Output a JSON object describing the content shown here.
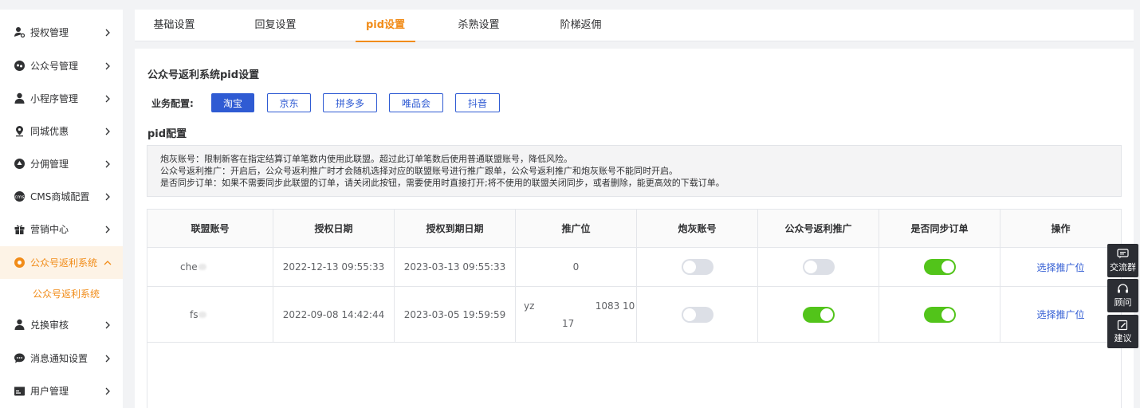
{
  "sidebar": {
    "items": [
      {
        "label": "授权管理",
        "icon": "user-key-icon",
        "active": false
      },
      {
        "label": "公众号管理",
        "icon": "chat-bubble-icon",
        "active": false
      },
      {
        "label": "小程序管理",
        "icon": "person-icon",
        "active": false
      },
      {
        "label": "同城优惠",
        "icon": "location-pin-icon",
        "active": false
      },
      {
        "label": "分佣管理",
        "icon": "triangle-badge-icon",
        "active": false
      },
      {
        "label": "CMS商城配置",
        "icon": "cms-icon",
        "active": false
      },
      {
        "label": "营销中心",
        "icon": "gift-icon",
        "active": false
      },
      {
        "label": "公众号返利系统",
        "icon": "orange-circle-icon",
        "active": true
      },
      {
        "label": "兑换审核",
        "icon": "person-check-icon",
        "active": false
      },
      {
        "label": "消息通知设置",
        "icon": "message-icon",
        "active": false
      },
      {
        "label": "用户管理",
        "icon": "id-card-icon",
        "active": false
      }
    ],
    "submenu": {
      "label": "公众号返利系统"
    }
  },
  "tabs": [
    {
      "label": "基础设置",
      "active": false
    },
    {
      "label": "回复设置",
      "active": false
    },
    {
      "label": "pid设置",
      "active": true
    },
    {
      "label": "杀熟设置",
      "active": false
    },
    {
      "label": "阶梯返佣",
      "active": false
    }
  ],
  "main": {
    "title": "公众号返利系统pid设置",
    "biz_label": "业务配置:",
    "biz_buttons": [
      {
        "label": "淘宝",
        "selected": true
      },
      {
        "label": "京东",
        "selected": false
      },
      {
        "label": "拼多多",
        "selected": false
      },
      {
        "label": "唯品会",
        "selected": false
      },
      {
        "label": "抖音",
        "selected": false
      }
    ],
    "pid_title": "pid配置",
    "notice_lines": [
      "炮灰账号：限制新客在指定结算订单笔数内使用此联盟。超过此订单笔数后使用普通联盟账号，降低风险。",
      "公众号返利推广：开启后，公众号返利推广时才会随机选择对应的联盟账号进行推广跟单，公众号返利推广和炮灰账号不能同时开启。",
      "是否同步订单：如果不需要同步此联盟的订单，请关闭此按钮，需要使用时直接打开;将不使用的联盟关闭同步，或者删除，能更高效的下载订单。"
    ]
  },
  "table": {
    "headers": [
      "联盟账号",
      "授权日期",
      "授权到期日期",
      "推广位",
      "炮灰账号",
      "公众号返利推广",
      "是否同步订单",
      "操作"
    ],
    "rows": [
      {
        "account": "che",
        "auth_date": "2022-12-13 09:55:33",
        "expire_date": "2023-03-13 09:55:33",
        "position_line1": "0",
        "position_line2": "",
        "cannon": false,
        "rebate": false,
        "sync": true,
        "action": "选择推广位"
      },
      {
        "account": "fs",
        "auth_date": "2022-09-08 14:42:44",
        "expire_date": "2023-03-05 19:59:59",
        "position_line1": "yz                    1083 10",
        "position_line2": "17",
        "cannon": false,
        "rebate": true,
        "sync": true,
        "action": "选择推广位"
      }
    ]
  },
  "float_buttons": [
    {
      "label": "交流群",
      "icon": "chat-group-icon"
    },
    {
      "label": "顾问",
      "icon": "headset-icon"
    },
    {
      "label": "建议",
      "icon": "edit-icon"
    }
  ],
  "colors": {
    "accent": "#f18c19",
    "primary": "#2f5bd3",
    "switch_on": "#52c41a",
    "switch_off": "#dcdfe6"
  }
}
